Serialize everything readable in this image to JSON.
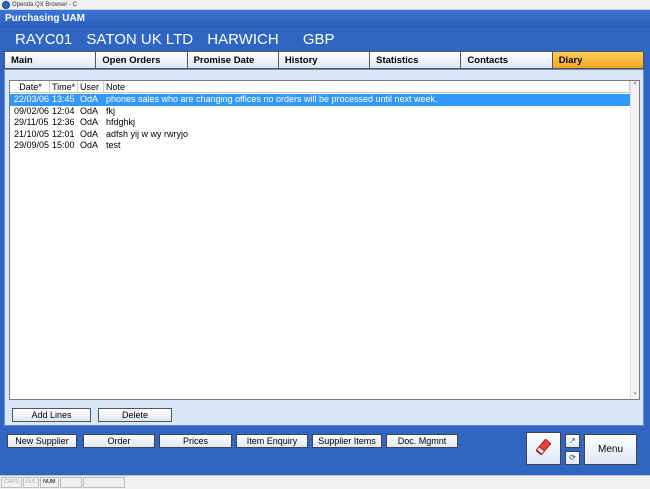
{
  "window": {
    "title": "Openda QX Browser - C"
  },
  "app": {
    "title": "Purchasing UAM"
  },
  "header": {
    "code": "RAYC01",
    "company": "SATON UK LTD",
    "location": "HARWICH",
    "currency": "GBP"
  },
  "tabs": [
    {
      "label": "Main"
    },
    {
      "label": "Open Orders"
    },
    {
      "label": "Promise Date"
    },
    {
      "label": "History"
    },
    {
      "label": "Statistics"
    },
    {
      "label": "Contacts"
    },
    {
      "label": "Diary",
      "active": true
    }
  ],
  "grid": {
    "columns": {
      "date": "Date*",
      "time": "Time*",
      "user": "User",
      "note": "Note"
    },
    "rows": [
      {
        "date": "22/03/06",
        "time": "13:45",
        "user": "OdA",
        "note": "phones sales who are changing offices  no orders will be processed until next week.",
        "selected": true
      },
      {
        "date": "09/02/06",
        "time": "12:04",
        "user": "OdA",
        "note": "fkj"
      },
      {
        "date": "29/11/05",
        "time": "12:36",
        "user": "OdA",
        "note": "hfdghkj"
      },
      {
        "date": "21/10/05",
        "time": "12:01",
        "user": "OdA",
        "note": "adfsh yij w wy rwryjo"
      },
      {
        "date": "29/09/05",
        "time": "15:00",
        "user": "OdA",
        "note": "test"
      }
    ]
  },
  "grid_actions": {
    "add_lines": "Add Lines",
    "delete": "Delete"
  },
  "nav_buttons": {
    "new_supplier": "New Supplier",
    "order": "Order",
    "prices": "Prices",
    "item_enquiry": "Item Enquiry",
    "supplier_items": "Supplier Items",
    "doc_mgmnt": "Doc. Mgmnt"
  },
  "menu": {
    "label": "Menu"
  },
  "icons": {
    "tool": "eraser-icon",
    "small_top": "help-icon",
    "small_bottom": "refresh-icon"
  },
  "status_bar": {
    "caps": "CAPS",
    "ins": "INS",
    "num": "NUM"
  },
  "colors": {
    "background": "#2f66c4",
    "active_tab": "#f2a722",
    "selection": "#3399ff"
  }
}
